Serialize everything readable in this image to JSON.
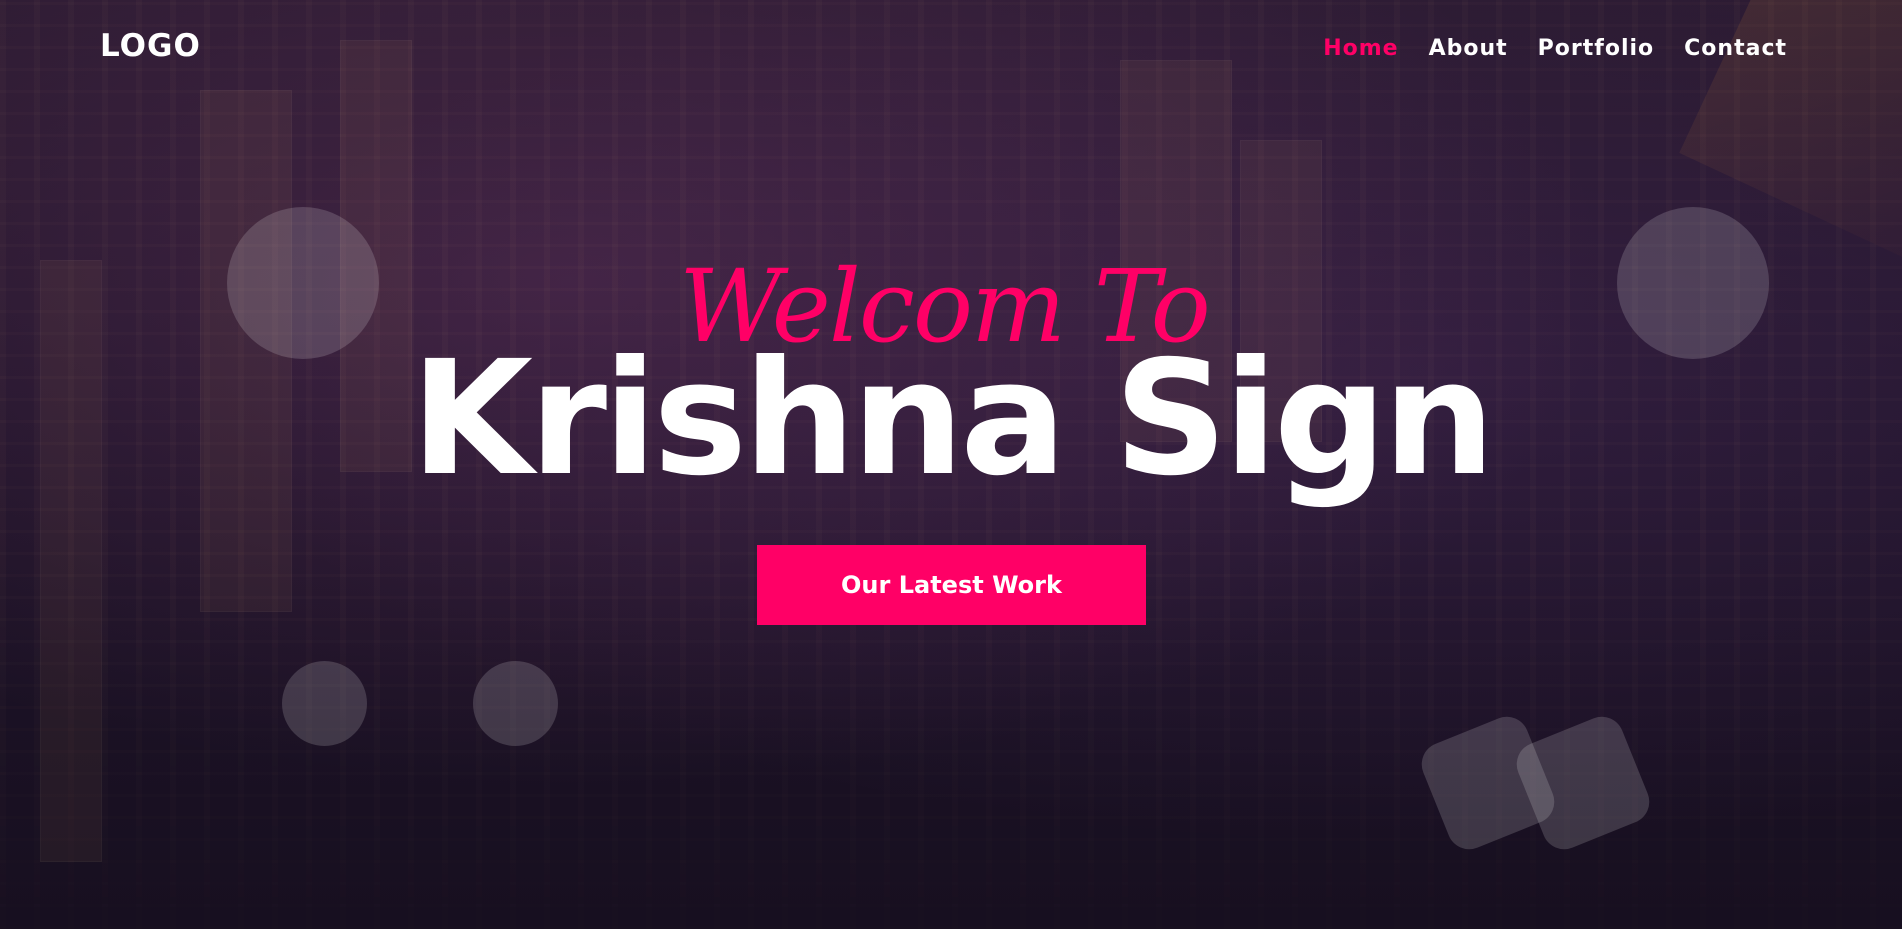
{
  "header": {
    "logo": "LOGO",
    "nav": [
      {
        "label": "Home",
        "active": true
      },
      {
        "label": "About",
        "active": false
      },
      {
        "label": "Portfolio",
        "active": false
      },
      {
        "label": "Contact",
        "active": false
      }
    ]
  },
  "hero": {
    "welcome": "Welcom To",
    "title": "Krishna Sign",
    "cta_label": "Our Latest Work"
  },
  "colors": {
    "accent": "#ff0066",
    "text": "#ffffff",
    "background": "#1b1124"
  }
}
